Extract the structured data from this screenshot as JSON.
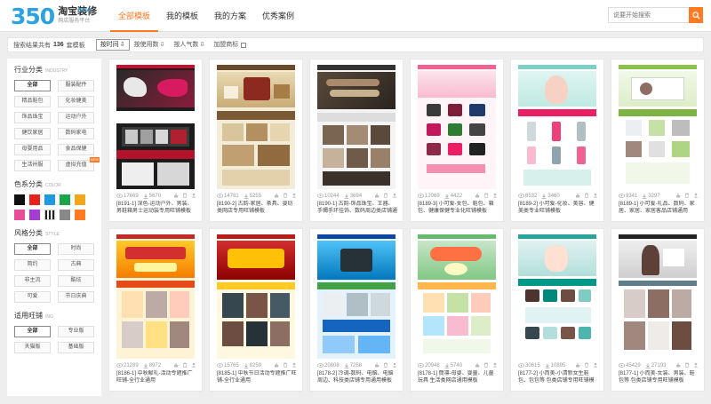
{
  "logo": {
    "number": "350",
    "title": "淘宝装修",
    "subtitle": "网店服务平台",
    "beta": "BETA!"
  },
  "nav": {
    "tabs": [
      "全部模板",
      "我的模板",
      "我的方案",
      "优秀案例"
    ]
  },
  "search": {
    "placeholder": "说要开始搜索"
  },
  "filter": {
    "prefix": "搜索结果共有",
    "count": "136",
    "suffix": "套模板",
    "sorts": [
      {
        "label": "按时间",
        "arrow": "⇩"
      },
      {
        "label": "按使用数",
        "arrow": "⇩"
      },
      {
        "label": "按人气数",
        "arrow": "⇩"
      },
      {
        "label": "加盟商标"
      }
    ]
  },
  "sidebar": {
    "industry": {
      "title": "行业分类",
      "en": "INDUSTRY",
      "items": [
        "全部",
        "服装配件",
        "精品鞋包",
        "化妆健美",
        "饰品珠宝",
        "运动户外",
        "健饮家居",
        "数码家电",
        "母婴用品",
        "食品保健",
        "生活卅服",
        "虚拟充值"
      ],
      "badge": "NEW"
    },
    "color": {
      "title": "色系分类",
      "en": "COLOR",
      "swatches": [
        "#111111",
        "#e8211c",
        "#1f9ae0",
        "#19a64a",
        "#f1a61c",
        "#e84d9a",
        "#a73bd6",
        "#f8f8f8",
        "#888888",
        "#ff7b21"
      ]
    },
    "style": {
      "title": "风格分类",
      "en": "STYLE",
      "items": [
        "全部",
        "时尚",
        "简约",
        "古典",
        "非主流",
        "酷炫",
        "可爱",
        "节日庆典"
      ]
    },
    "layout": {
      "title": "适用旺铺",
      "en": "ING",
      "items": [
        "全部",
        "专业版",
        "天猫版",
        "基础版"
      ]
    }
  },
  "cards": [
    {
      "views": "17669",
      "uses": "5670",
      "desc": "[8191-1] 深色-运动户外、男装、男鞋箱男士运动装专用旺铺模板"
    },
    {
      "views": "14781",
      "uses": "5255",
      "desc": "[8190-2] 古韵-家居、茶具、婴纺类网店专用旺铺模板"
    },
    {
      "views": "10244",
      "uses": "3694",
      "desc": "[8190-1] 古韵-饰品珠宝、王器、手镯手环挂饰、数码周边类店铺通用旺铺"
    },
    {
      "views": "12069",
      "uses": "4422",
      "desc": "[8189-3] 小可爱-女包、鞋包、箱包、健康保健专业化旺铺模板"
    },
    {
      "views": "8532",
      "uses": "3460",
      "desc": "[8189-2] 小可爱-化妆、美容、健美类专业旺铺模板"
    },
    {
      "views": "9341",
      "uses": "3297",
      "desc": "[8189-1] 小可爱-礼品、数码、家居、家居、家居客品店铺通用"
    },
    {
      "views": "21289",
      "uses": "8972",
      "desc": "[8186-1] 中秋献礼-活动专题推广旺铺-全行业通用"
    },
    {
      "views": "15765",
      "uses": "8259",
      "desc": "[8185-1] 中秋节日活动专题推广旺铺-全行业通用"
    },
    {
      "views": "20808",
      "uses": "7258",
      "desc": "[8178-2] 冷调-数码、电脑、电脑周边、科技类店铺专用通用模板"
    },
    {
      "views": "20948",
      "uses": "5740",
      "desc": "[8178-1] 簡凛-母婴、婴童、儿童玩具 生活类网店通用模板"
    },
    {
      "views": "30615",
      "uses": "10895",
      "desc": "[8177-2] 小而美-小清新女生鞋包、包包等 包类店铺专用旺铺模板"
    },
    {
      "views": "45429",
      "uses": "27193",
      "desc": "[8177-1] 小而美-女装、男装、鞋包等 包类店铺专用旺铺模板"
    }
  ],
  "thumbs": {
    "t1": "",
    "t2": "",
    "t3": "",
    "t4": "",
    "t5": "",
    "t6": "",
    "t7": "",
    "t8": "",
    "t9": "",
    "t10": "",
    "t11": "",
    "t12": ""
  }
}
